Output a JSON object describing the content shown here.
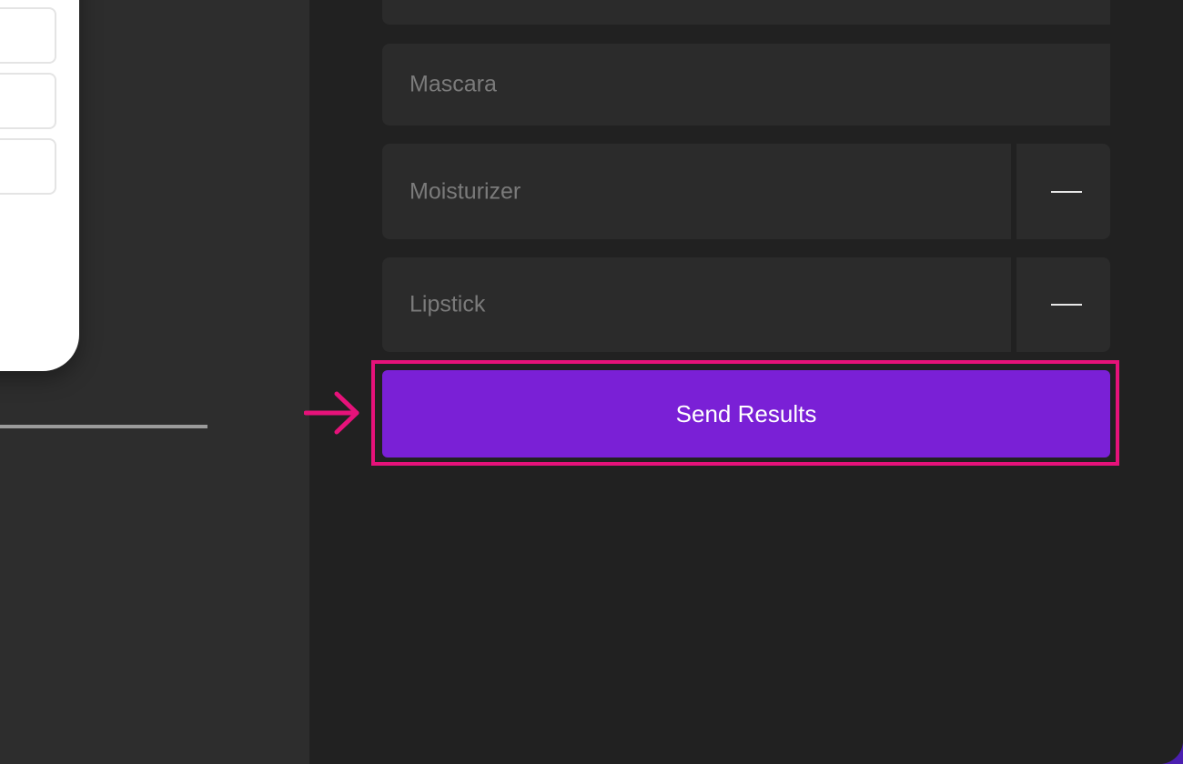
{
  "form": {
    "items": [
      {
        "label": "Mascara",
        "removable": false
      },
      {
        "label": "Moisturizer",
        "removable": true
      },
      {
        "label": "Lipstick",
        "removable": true
      }
    ],
    "submit_label": "Send Results"
  },
  "icons": {
    "remove": "minus-icon",
    "pointer": "arrow-right-icon"
  },
  "colors": {
    "accent": "#7a20d6",
    "highlight": "#e6127a",
    "panel": "#212121",
    "field": "#2b2b2b"
  }
}
